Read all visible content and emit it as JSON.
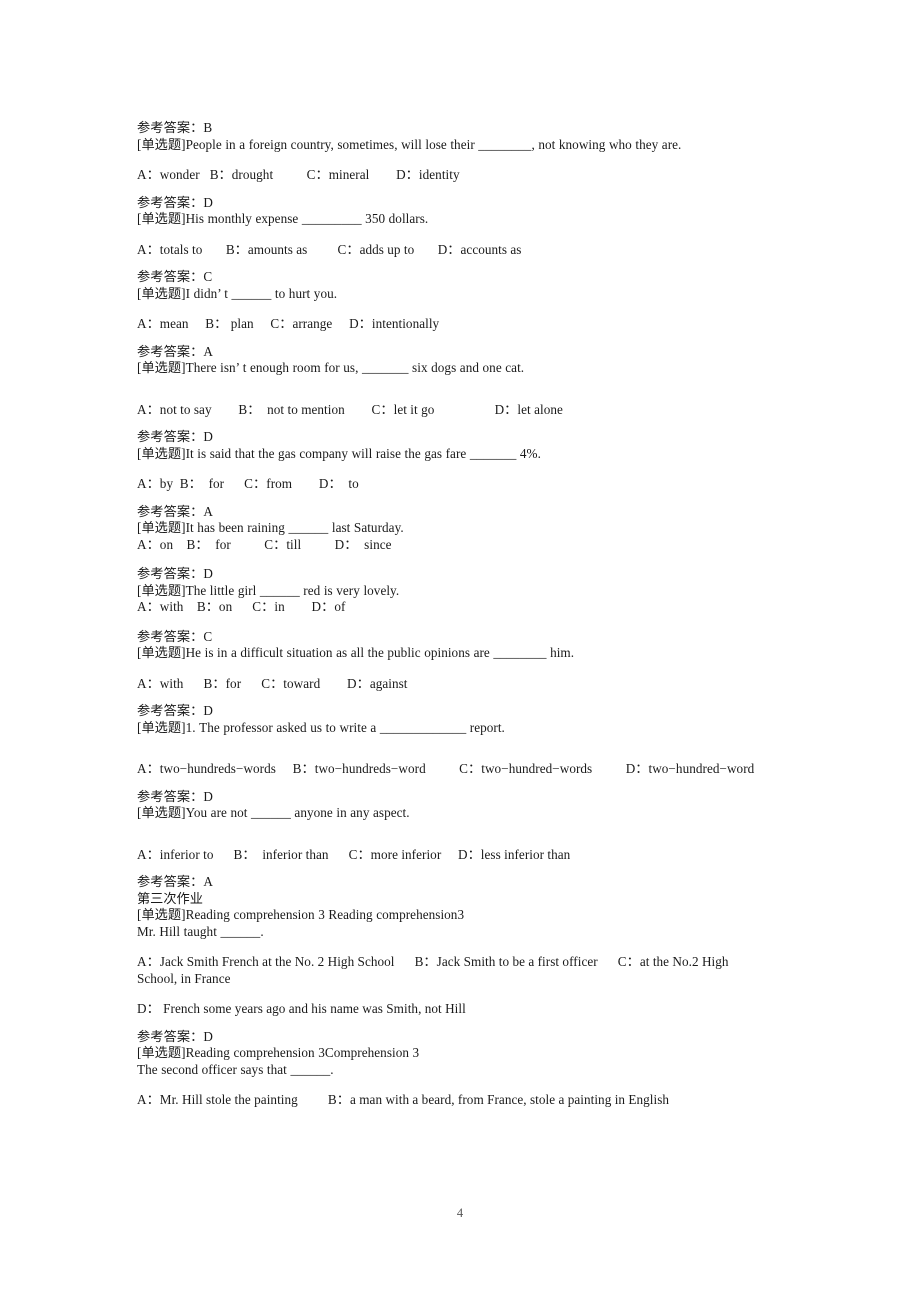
{
  "document": {
    "page_number": "4",
    "answer_label": "参考答案：",
    "question_tag": "[单选题]",
    "section_heading": "第三次作业"
  },
  "blocks": [
    {
      "answer": "参考答案：B",
      "stem": "[单选题]People in a foreign country, sometimes, will lose their ________, not knowing who they are.",
      "options": "A：wonder   B：drought          C：mineral        D：identity",
      "spacing": "normal"
    },
    {
      "answer": "参考答案：D",
      "stem": "[单选题]His monthly expense _________ 350 dollars.",
      "options": "A：totals to       B：amounts as         C：adds up to       D：accounts as",
      "spacing": "normal"
    },
    {
      "answer": "参考答案：C",
      "stem": "[单选题]I didn’ t ______ to hurt you.",
      "options": "A：mean     B： plan     C：arrange     D：intentionally",
      "spacing": "normal"
    },
    {
      "answer": "参考答案：A",
      "stem": "[单选题]There isn’ t enough room for us, _______ six dogs and one cat.",
      "options": "A：not to say        B：  not to mention        C：let it go                  D：let alone",
      "spacing": "wide"
    },
    {
      "answer": "参考答案：D",
      "stem": "[单选题]It is said that the gas company will raise the gas fare _______ 4%.",
      "options": "A：by  B：  for      C：from        D：  to",
      "spacing": "normal"
    },
    {
      "answer": "参考答案：A",
      "stem": "[单选题]It has been raining ______ last Saturday.",
      "options": "A：on    B：  for          C：till          D：  since",
      "spacing": "tight"
    },
    {
      "answer": "参考答案：D",
      "stem": "[单选题]The little girl ______ red is very lovely.",
      "options": "A：with    B：on      C：in        D：of",
      "spacing": "tight"
    },
    {
      "answer": "参考答案：C",
      "stem": "[单选题]He is in a difficult situation as all the public opinions are ________ him.",
      "options": "A：with      B：for      C：toward        D：against",
      "spacing": "normal"
    },
    {
      "answer": "参考答案：D",
      "stem": "[单选题]1. The professor asked us to write a _____________ report.",
      "options": "A：two−hundreds−words     B：two−hundreds−word          C：two−hundred−words          D：two−hundred−word",
      "spacing": "wide"
    },
    {
      "answer": "参考答案：D",
      "stem": "[单选题]You are not ______ anyone in any aspect.",
      "options": "A：inferior to      B：  inferior than      C：more inferior     D：less inferior than",
      "spacing": "wide"
    },
    {
      "answer": "参考答案：A",
      "heading": "第三次作业",
      "stem": "[单选题]Reading comprehension 3 Reading comprehension3\nMr. Hill taught ______.",
      "options": "A：Jack Smith French at the No. 2 High School      B：Jack Smith to be a first officer      C：at the No.2 High School, in France",
      "options_extra": "D： French some years ago and his name was Smith, not Hill",
      "spacing": "normal"
    },
    {
      "answer": "参考答案：D",
      "stem": "[单选题]Reading comprehension 3Comprehension 3\nThe second officer says that ______.",
      "options": "A：Mr. Hill stole the painting         B：a man with a beard, from France, stole a painting in English",
      "spacing": "normal"
    }
  ]
}
